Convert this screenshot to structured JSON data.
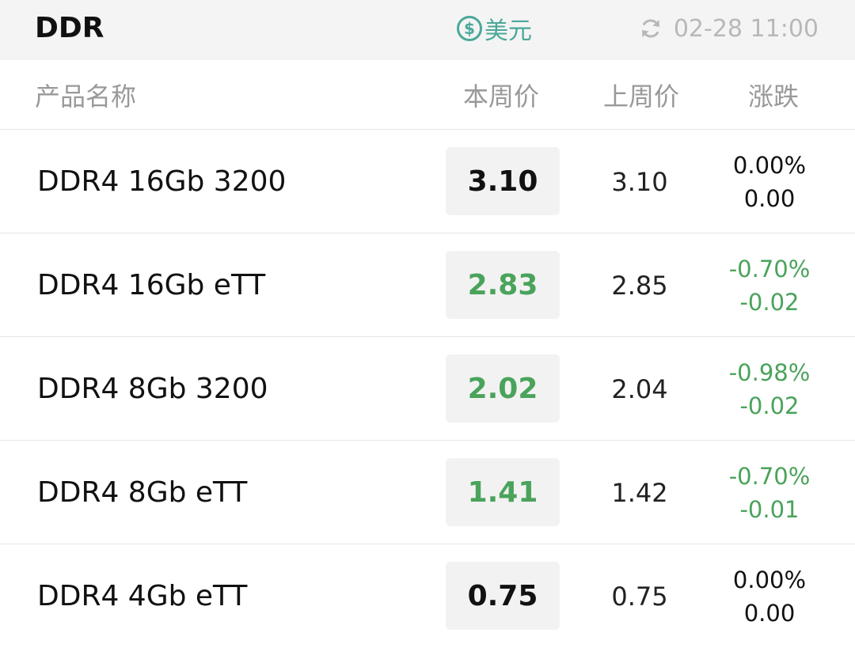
{
  "header": {
    "title": "DDR",
    "currency_label": "美元",
    "updated": "02-28 11:00"
  },
  "columns": {
    "name": "产品名称",
    "this_week": "本周价",
    "last_week": "上周价",
    "change": "涨跌"
  },
  "colors": {
    "accent": "#4aa89a",
    "down": "#4aa35b",
    "flat": "#111111",
    "muted": "#999999"
  },
  "rows": [
    {
      "name": "DDR4 16Gb 3200",
      "this_week": "3.10",
      "last_week": "3.10",
      "change_pct": "0.00%",
      "change_abs": "0.00",
      "trend": "flat"
    },
    {
      "name": "DDR4 16Gb eTT",
      "this_week": "2.83",
      "last_week": "2.85",
      "change_pct": "-0.70%",
      "change_abs": "-0.02",
      "trend": "down"
    },
    {
      "name": "DDR4 8Gb 3200",
      "this_week": "2.02",
      "last_week": "2.04",
      "change_pct": "-0.98%",
      "change_abs": "-0.02",
      "trend": "down"
    },
    {
      "name": "DDR4 8Gb eTT",
      "this_week": "1.41",
      "last_week": "1.42",
      "change_pct": "-0.70%",
      "change_abs": "-0.01",
      "trend": "down"
    },
    {
      "name": "DDR4 4Gb eTT",
      "this_week": "0.75",
      "last_week": "0.75",
      "change_pct": "0.00%",
      "change_abs": "0.00",
      "trend": "flat"
    }
  ]
}
